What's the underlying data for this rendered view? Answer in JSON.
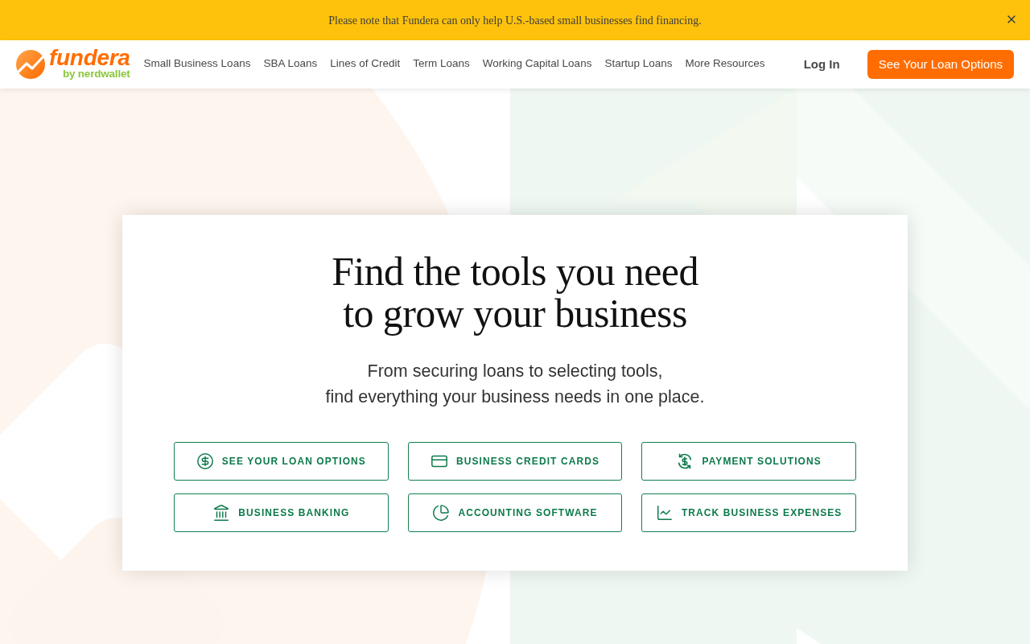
{
  "banner": {
    "message": "Please note that Fundera can only help U.S.-based small businesses find financing."
  },
  "header": {
    "logo": {
      "wordmark": "fundera",
      "tagline": "by nerdwallet"
    },
    "nav": [
      "Small Business Loans",
      "SBA Loans",
      "Lines of Credit",
      "Term Loans",
      "Working Capital Loans",
      "Startup Loans",
      "More Resources"
    ],
    "login": "Log In",
    "cta": "See Your Loan Options"
  },
  "hero": {
    "title_lines": [
      "Find the tools you need",
      "to grow your business"
    ],
    "subtitle_lines": [
      "From securing loans to selecting tools,",
      "find everything your business needs in one place."
    ],
    "actions": [
      "SEE YOUR LOAN OPTIONS",
      "BUSINESS CREDIT CARDS",
      "PAYMENT SOLUTIONS",
      "BUSINESS BANKING",
      "ACCOUNTING SOFTWARE",
      "TRACK BUSINESS EXPENSES"
    ]
  }
}
